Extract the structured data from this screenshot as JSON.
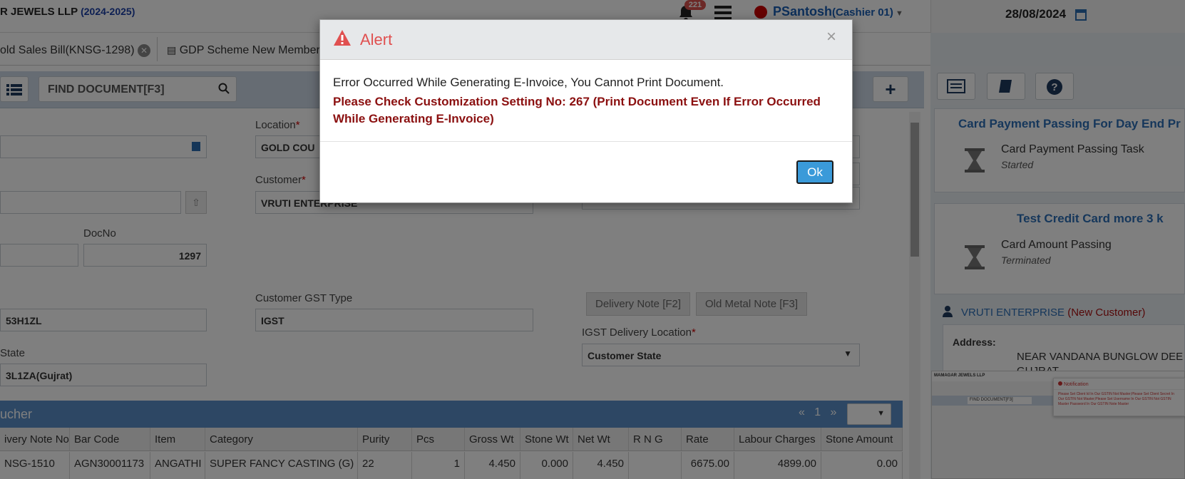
{
  "header": {
    "company": "R JEWELS LLP",
    "year": "(2024-2025)",
    "notification_count": "221",
    "user_name": "PSantosh",
    "user_role": "(Cashier 01)",
    "date": "28/08/2024"
  },
  "tabs": [
    {
      "label": "old Sales Bill(KNSG-1298)"
    },
    {
      "label": "GDP Scheme New Member"
    }
  ],
  "toolbar": {
    "find_placeholder": "FIND DOCUMENT[F3]"
  },
  "form": {
    "location_label": "Location",
    "location_value": "GOLD COU",
    "customer_label": "Customer",
    "customer_value": "VRUTI ENTERPRISE",
    "docno_label": "DocNo",
    "docno_value": "1297",
    "gstin_value": "53H1ZL",
    "customer_gst_type_label": "Customer GST Type",
    "customer_gst_type_value": "IGST",
    "state_label": "State",
    "state_value": "3L1ZA(Gujrat)",
    "delivery_note_btn": "Delivery Note [F2]",
    "old_metal_note_btn": "Old Metal Note [F3]",
    "igst_delivery_label": "IGST Delivery Location",
    "igst_delivery_value": "Customer State"
  },
  "section": {
    "title": "ucher",
    "page_prev": "«",
    "page_num": "1",
    "page_next": "»"
  },
  "grid": {
    "columns": [
      "ivery Note No",
      "Bar Code",
      "Item",
      "Category",
      "Purity",
      "Pcs",
      "Gross Wt",
      "Stone Wt",
      "Net Wt",
      "R N G",
      "Rate",
      "Labour Charges",
      "Stone Amount"
    ],
    "rows": [
      [
        "NSG-1510",
        "AGN30001173",
        "ANGATHI",
        "SUPER FANCY CASTING (G)",
        "22",
        "1",
        "4.450",
        "0.000",
        "4.450",
        "",
        "6675.00",
        "4899.00",
        "0.00"
      ]
    ]
  },
  "right_panel": {
    "card1_title": "Card Payment Passing For Day End Pr",
    "card1_task": "Card Payment Passing Task",
    "card1_status": "Started",
    "card2_title": "Test Credit Card more 3 k",
    "card2_task": "Card Amount Passing",
    "card2_status": "Terminated",
    "customer_name": "VRUTI ENTERPRISE",
    "customer_tag": "(New Customer)",
    "address_label": "Address:",
    "address_line1": "NEAR VANDANA BUNGLOW DEE",
    "address_line2": "GUJRAT"
  },
  "thumbnail": {
    "notification_title": "Notification",
    "notification_text": "Please Set Client Id In Our GSTIN Not Master;Please Set Client Secret In Our GSTIN Not Master;Please Set Username In Our GSTIN Not GSTIN Master Password In Our GSTIN Note Master"
  },
  "modal": {
    "title": "Alert",
    "close": "×",
    "message": "Error Occurred While Generating E-Invoice, You Cannot Print Document.",
    "detail": "Please Check Customization Setting No: 267 (Print Document Even If Error Occurred While Generating E-Invoice)",
    "ok_label": "Ok"
  },
  "colors": {
    "accent": "#3a9ad9",
    "alert_title": "#e05050",
    "error_text": "#8b1010",
    "section_bar": "#5b8fc9"
  }
}
